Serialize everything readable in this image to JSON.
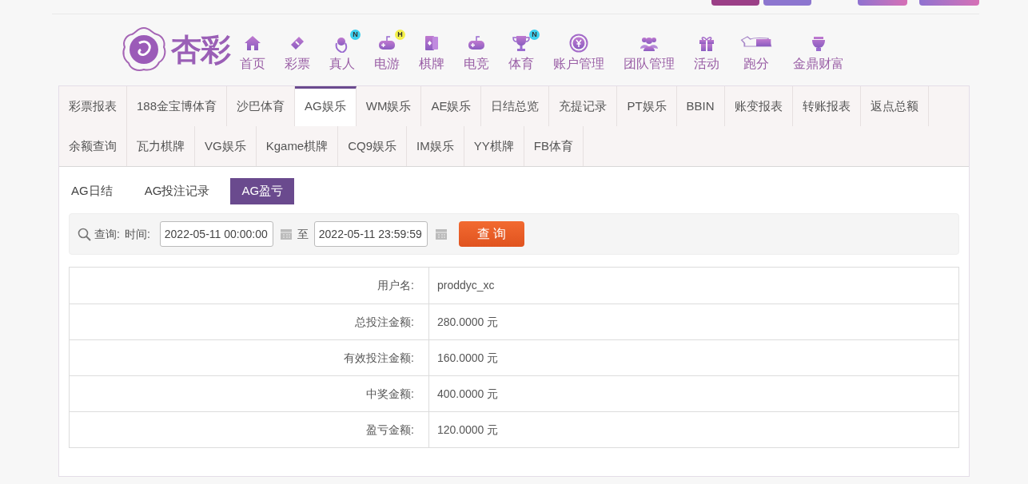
{
  "nav": {
    "items": [
      {
        "label": "首页"
      },
      {
        "label": "彩票"
      },
      {
        "label": "真人",
        "badge": "N",
        "color": "#3dd0ee"
      },
      {
        "label": "电游",
        "badge": "H",
        "color": "#f3f04a"
      },
      {
        "label": "棋牌"
      },
      {
        "label": "电竞"
      },
      {
        "label": "体育",
        "badge": "N",
        "color": "#3dd0ee"
      },
      {
        "label": "账户管理"
      },
      {
        "label": "团队管理"
      },
      {
        "label": "活动"
      },
      {
        "label": "跑分"
      },
      {
        "label": "金鼎财富"
      }
    ]
  },
  "logo": {
    "text": "杏彩"
  },
  "report_tabs": [
    [
      {
        "label": "彩票报表",
        "selected": false
      },
      {
        "label": "188金宝博体育",
        "selected": false
      },
      {
        "label": "沙巴体育",
        "selected": false
      },
      {
        "label": "AG娱乐",
        "selected": true
      },
      {
        "label": "WM娱乐",
        "selected": false
      },
      {
        "label": "AE娱乐",
        "selected": false
      },
      {
        "label": "日结总览",
        "selected": false
      },
      {
        "label": "充提记录",
        "selected": false
      },
      {
        "label": "PT娱乐",
        "selected": false
      },
      {
        "label": "BBIN",
        "selected": false
      },
      {
        "label": "账变报表",
        "selected": false
      },
      {
        "label": "转账报表",
        "selected": false
      },
      {
        "label": "返点总额",
        "selected": false
      }
    ],
    [
      {
        "label": "余额查询",
        "selected": false
      },
      {
        "label": "瓦力棋牌",
        "selected": false
      },
      {
        "label": "VG娱乐",
        "selected": false
      },
      {
        "label": "Kgame棋牌",
        "selected": false
      },
      {
        "label": "CQ9娱乐",
        "selected": false
      },
      {
        "label": "IM娱乐",
        "selected": false
      },
      {
        "label": "YY棋牌",
        "selected": false
      },
      {
        "label": "FB体育",
        "selected": false
      }
    ]
  ],
  "sub_tabs": [
    {
      "label": "AG日结",
      "selected": false
    },
    {
      "label": "AG投注记录",
      "selected": false
    },
    {
      "label": "AG盈亏",
      "selected": true
    }
  ],
  "query": {
    "label": "查询:",
    "time_label": "时间:",
    "start": "2022-05-11 00:00:00",
    "separator": "至",
    "end": "2022-05-11 23:59:59",
    "button": "查 询"
  },
  "table": {
    "rows": [
      {
        "label": "用户名:",
        "value": "proddyc_xc"
      },
      {
        "label": "总投注金额:",
        "value": "280.0000 元"
      },
      {
        "label": "有效投注金额:",
        "value": "160.0000 元"
      },
      {
        "label": "中奖金额:",
        "value": "400.0000 元"
      },
      {
        "label": "盈亏金额:",
        "value": "120.0000 元"
      }
    ]
  }
}
